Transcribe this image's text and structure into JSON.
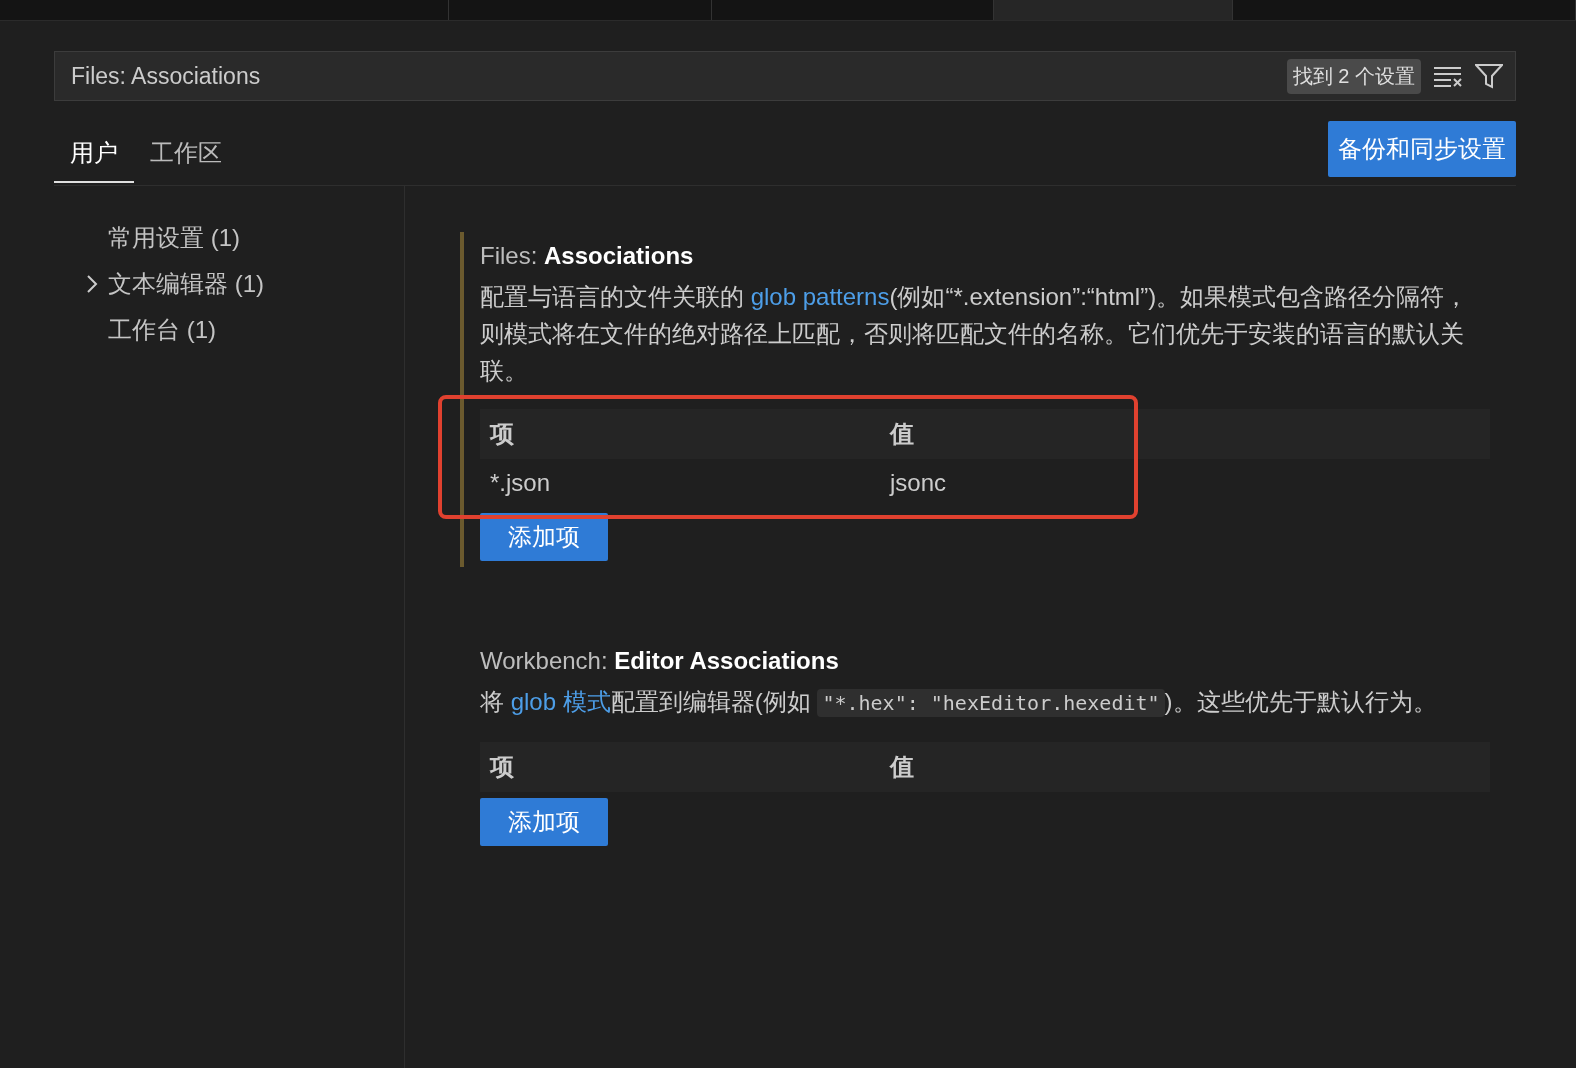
{
  "editor_tabs": [
    {
      "selected": false
    },
    {
      "selected": false
    },
    {
      "selected": false
    },
    {
      "selected": true
    },
    {
      "selected": false
    }
  ],
  "search": {
    "value": "Files: Associations",
    "count": "找到 2 个设置"
  },
  "scope_tabs": [
    {
      "label": "用户",
      "selected": true
    },
    {
      "label": "工作区",
      "selected": false
    }
  ],
  "sync_button": "备份和同步设置",
  "toc": [
    {
      "label": "常用设置 (1)",
      "expandable": false
    },
    {
      "label": "文本编辑器 (1)",
      "expandable": true
    },
    {
      "label": "工作台 (1)",
      "expandable": false
    }
  ],
  "settings": [
    {
      "category": "Files:",
      "name": "Associations",
      "modified": true,
      "highlighted": true,
      "description": [
        {
          "kind": "text",
          "text": "配置与语言的文件关联的 "
        },
        {
          "kind": "link",
          "text": "glob patterns"
        },
        {
          "kind": "text",
          "text": "(例如“*.extension”:“html”)。如果模式包含路径分隔符，则模式将在文件的绝对路径上匹配，否则将匹配文件的名称。它们优先于安装的语言的默认关联。"
        }
      ],
      "columns": [
        "项",
        "值"
      ],
      "rows": [
        [
          "*.json",
          "jsonc"
        ]
      ],
      "add_button": "添加项"
    },
    {
      "category": "Workbench:",
      "name": "Editor Associations",
      "modified": false,
      "highlighted": false,
      "description": [
        {
          "kind": "text",
          "text": "将 "
        },
        {
          "kind": "link",
          "text": "glob 模式"
        },
        {
          "kind": "text",
          "text": "配置到编辑器(例如 "
        },
        {
          "kind": "code",
          "text": "\"*.hex\": \"hexEditor.hexedit\""
        },
        {
          "kind": "text",
          "text": ")。这些优先于默认行为。"
        }
      ],
      "columns": [
        "项",
        "值"
      ],
      "add_button": "添加项"
    }
  ]
}
